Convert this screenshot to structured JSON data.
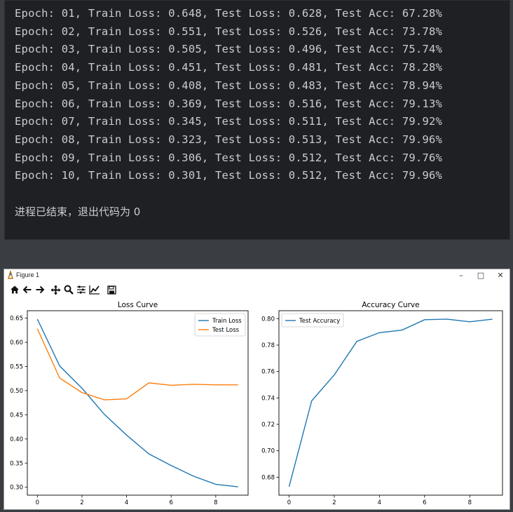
{
  "console": {
    "lines": [
      "Epoch: 01, Train Loss: 0.648, Test Loss: 0.628, Test Acc: 67.28%",
      "Epoch: 02, Train Loss: 0.551, Test Loss: 0.526, Test Acc: 73.78%",
      "Epoch: 03, Train Loss: 0.505, Test Loss: 0.496, Test Acc: 75.74%",
      "Epoch: 04, Train Loss: 0.451, Test Loss: 0.481, Test Acc: 78.28%",
      "Epoch: 05, Train Loss: 0.408, Test Loss: 0.483, Test Acc: 78.94%",
      "Epoch: 06, Train Loss: 0.369, Test Loss: 0.516, Test Acc: 79.13%",
      "Epoch: 07, Train Loss: 0.345, Test Loss: 0.511, Test Acc: 79.92%",
      "Epoch: 08, Train Loss: 0.323, Test Loss: 0.513, Test Acc: 79.96%",
      "Epoch: 09, Train Loss: 0.306, Test Loss: 0.512, Test Acc: 79.76%",
      "Epoch: 10, Train Loss: 0.301, Test Loss: 0.512, Test Acc: 79.96%"
    ],
    "exit_message": "进程已结束，退出代码为 0"
  },
  "window": {
    "title": "Figure 1",
    "minimize": "–",
    "maximize": "□",
    "close": "✕"
  },
  "toolbar": {
    "icons": [
      "home-icon",
      "back-arrow-icon",
      "forward-arrow-icon",
      "pan-icon",
      "zoom-icon",
      "subplots-icon",
      "edit-axis-icon",
      "save-icon"
    ]
  },
  "colors": {
    "train": "#1f77b4",
    "test": "#ff7f0e",
    "axis": "#000000"
  },
  "chart_data": [
    {
      "type": "line",
      "title": "Loss Curve",
      "x": [
        0,
        1,
        2,
        3,
        4,
        5,
        6,
        7,
        8,
        9
      ],
      "series": [
        {
          "name": "Train Loss",
          "values": [
            0.648,
            0.551,
            0.505,
            0.451,
            0.408,
            0.369,
            0.345,
            0.323,
            0.306,
            0.301
          ]
        },
        {
          "name": "Test Loss",
          "values": [
            0.628,
            0.526,
            0.496,
            0.481,
            0.483,
            0.516,
            0.511,
            0.513,
            0.512,
            0.512
          ]
        }
      ],
      "xticks": [
        0,
        2,
        4,
        6,
        8
      ],
      "yticks": [
        0.3,
        0.35,
        0.4,
        0.45,
        0.5,
        0.55,
        0.6,
        0.65
      ],
      "ytick_labels": [
        "0.30",
        "0.35",
        "0.40",
        "0.45",
        "0.50",
        "0.55",
        "0.60",
        "0.65"
      ],
      "xlim": [
        -0.45,
        9.45
      ],
      "ylim": [
        0.2836,
        0.6654
      ],
      "legend": "upper-right"
    },
    {
      "type": "line",
      "title": "Accuracy Curve",
      "x": [
        0,
        1,
        2,
        3,
        4,
        5,
        6,
        7,
        8,
        9
      ],
      "series": [
        {
          "name": "Test Accuracy",
          "values": [
            0.6728,
            0.7378,
            0.7574,
            0.7828,
            0.7894,
            0.7913,
            0.7992,
            0.7996,
            0.7976,
            0.7996
          ]
        }
      ],
      "xticks": [
        0,
        2,
        4,
        6,
        8
      ],
      "yticks": [
        0.68,
        0.7,
        0.72,
        0.74,
        0.76,
        0.78,
        0.8
      ],
      "ytick_labels": [
        "0.68",
        "0.70",
        "0.72",
        "0.74",
        "0.76",
        "0.78",
        "0.80"
      ],
      "xlim": [
        -0.45,
        9.45
      ],
      "ylim": [
        0.6664,
        0.806
      ],
      "legend": "upper-left"
    }
  ]
}
